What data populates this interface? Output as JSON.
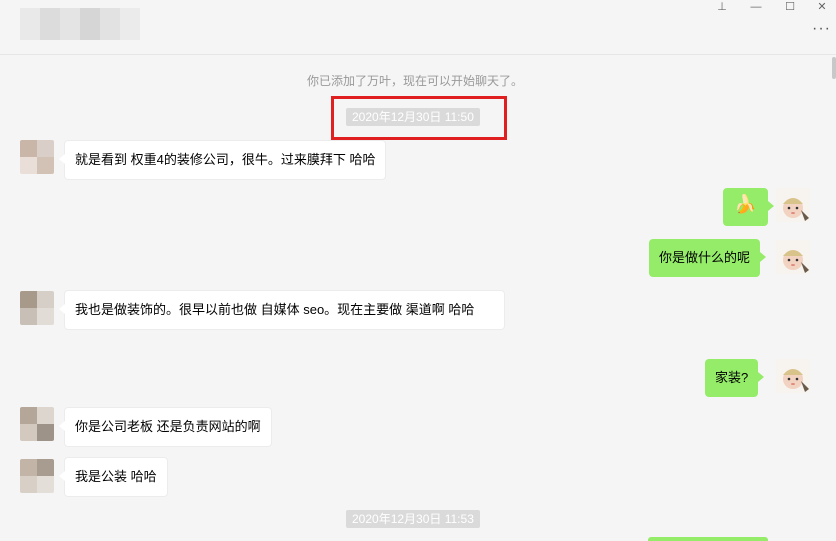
{
  "window": {
    "pin_icon": "pin-icon",
    "minimize_icon": "minimize-icon",
    "maximize_icon": "maximize-icon",
    "close_icon": "close-icon",
    "more_icon": "more-dots-icon",
    "pin_glyph": "⊥",
    "minimize_glyph": "—",
    "maximize_glyph": "☐",
    "close_glyph": "✕",
    "more_glyph": "···"
  },
  "chat": {
    "system_notice": "你已添加了万叶，现在可以开始聊天了。",
    "timestamps": [
      "2020年12月30日 11:50",
      "2020年12月30日 11:53"
    ],
    "messages": [
      {
        "side": "left",
        "text": "就是看到  权重4的装修公司，很牛。过来膜拜下 哈哈"
      },
      {
        "side": "right",
        "text": "🍌",
        "emoji": "banana-emoji"
      },
      {
        "side": "right",
        "text": "你是做什么的呢"
      },
      {
        "side": "left",
        "text": "我也是做装饰的。很早以前也做 自媒体 seo。现在主要做  渠道啊 哈哈"
      },
      {
        "side": "right",
        "text": "家装?"
      },
      {
        "side": "left",
        "text": "你是公司老板 还是负责网站的啊"
      },
      {
        "side": "left",
        "text": "我是公装 哈哈"
      }
    ]
  },
  "colors": {
    "background": "#f5f5f5",
    "bubble_left": "#ffffff",
    "bubble_right": "#95ec69",
    "timestamp_bg": "#dadada",
    "highlight_border": "#e02020"
  }
}
